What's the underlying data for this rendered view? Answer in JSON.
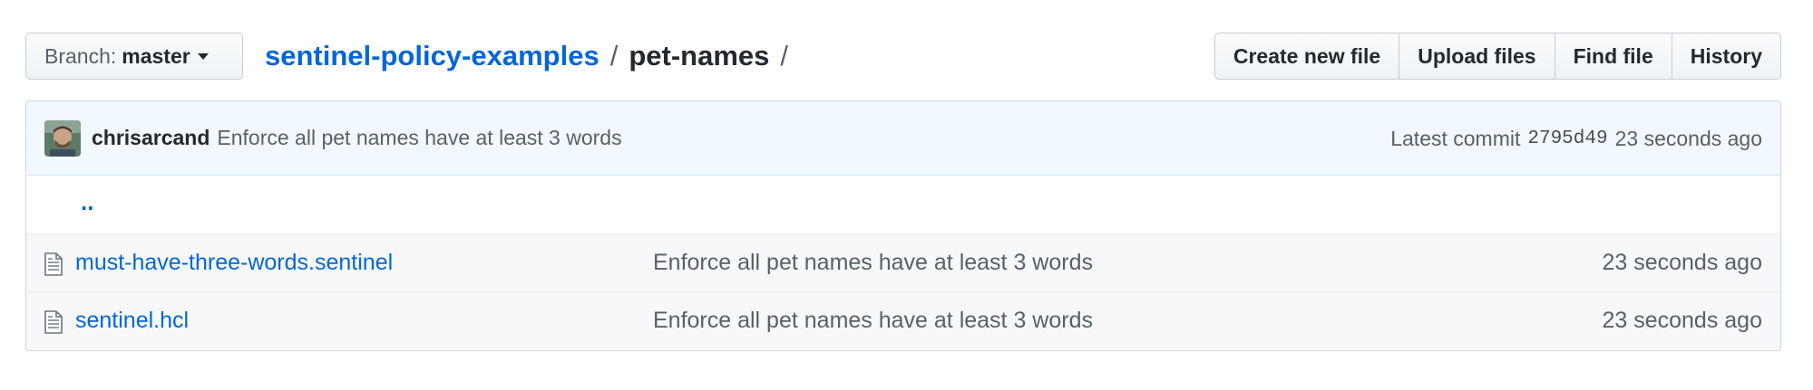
{
  "branch": {
    "prefix": "Branch:",
    "name": "master"
  },
  "breadcrumb": {
    "repo": "sentinel-policy-examples",
    "separator": "/",
    "folder": "pet-names",
    "trailing": "/"
  },
  "actions": {
    "create_new_file": "Create new file",
    "upload_files": "Upload files",
    "find_file": "Find file",
    "history": "History"
  },
  "latest_commit": {
    "author": "chrisarcand",
    "message": "Enforce all pet names have at least 3 words",
    "label": "Latest commit",
    "sha": "2795d49",
    "age": "23 seconds ago"
  },
  "parent_dir": "..",
  "files": [
    {
      "name": "must-have-three-words.sentinel",
      "commit_message": "Enforce all pet names have at least 3 words",
      "age": "23 seconds ago"
    },
    {
      "name": "sentinel.hcl",
      "commit_message": "Enforce all pet names have at least 3 words",
      "age": "23 seconds ago"
    }
  ],
  "colors": {
    "link": "#0366d6",
    "commit_bar_bg": "#f1f8ff",
    "muted_text": "#586069"
  },
  "icons": {
    "file": "file-text-icon",
    "caret": "caret-down-icon"
  }
}
